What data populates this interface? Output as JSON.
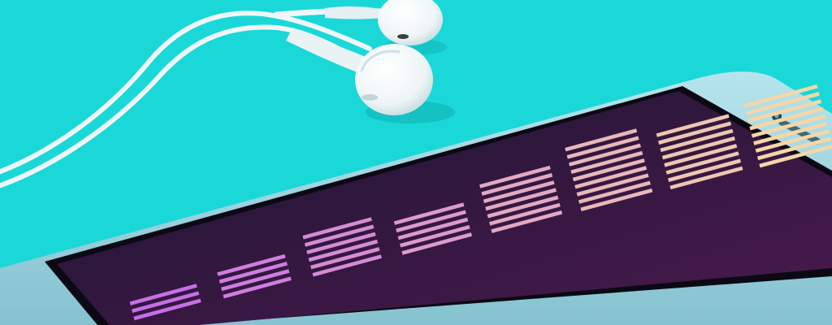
{
  "scene": {
    "background": "#1ad8d8",
    "shadow_color": "#12b9bb"
  },
  "earphones": {
    "color": "#f2f7f8",
    "shade_color": "#c9dde0",
    "count": 2
  },
  "phone": {
    "body_color": "#9fd3dd",
    "bezel_color": "#0b0a14",
    "screen_top_color": "#1c1530",
    "screen_bottom_color": "#4a1a4e",
    "speaker_icon": "speaker-grille-icon",
    "camera_icon": "camera-icon"
  },
  "equalizer": {
    "bar_count": 8,
    "levels": [
      0.34,
      0.38,
      0.56,
      0.52,
      0.72,
      0.86,
      0.78,
      0.94
    ],
    "color_left": "#c86ee8",
    "color_right": "#f6d6a8"
  }
}
